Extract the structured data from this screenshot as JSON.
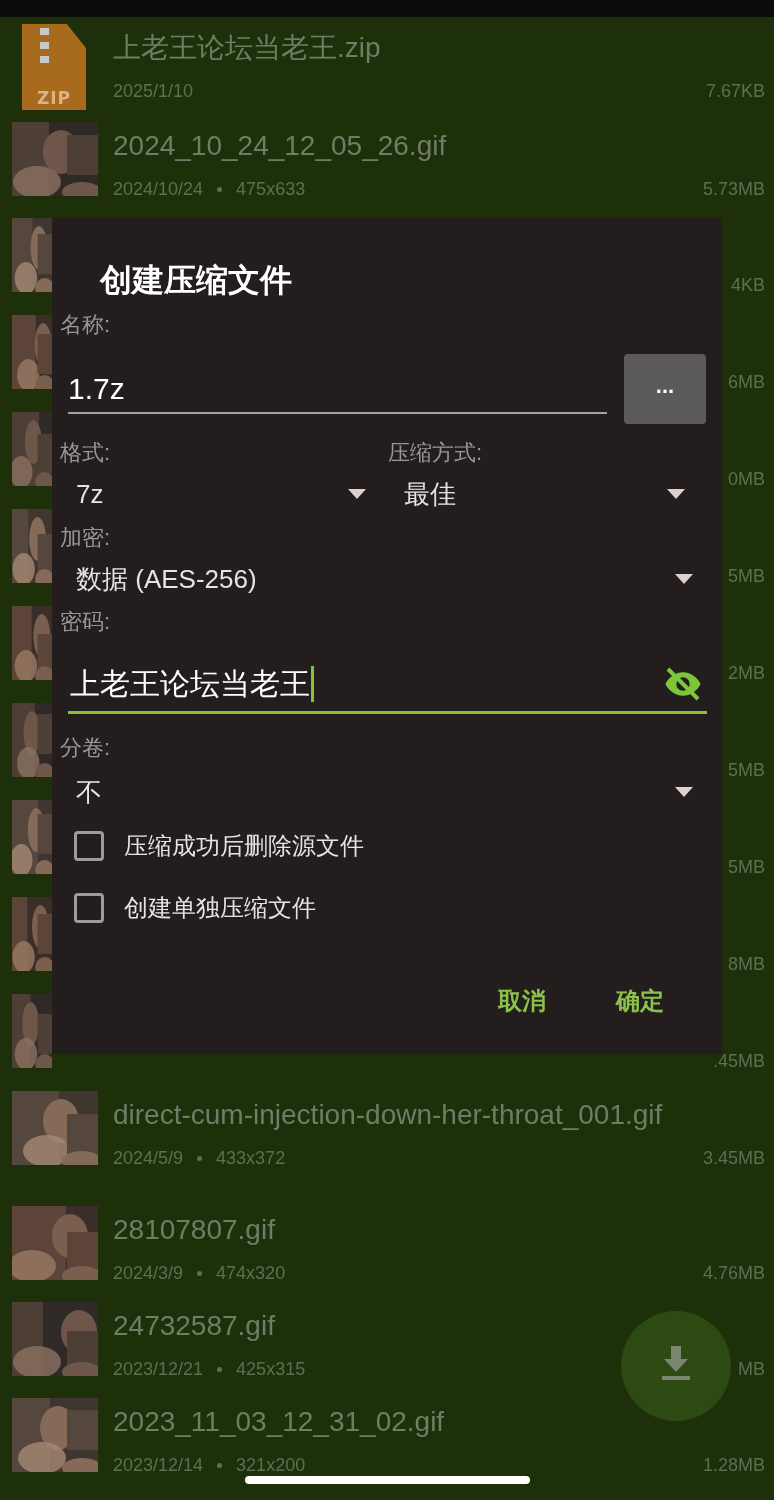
{
  "file_list": {
    "rows": [
      {
        "kind": "zip",
        "icon_label": "ZIP",
        "name": "上老王论坛当老王.zip",
        "date": "2025/1/10",
        "size": "7.67KB"
      },
      {
        "name": "2024_10_24_12_05_26.gif",
        "date": "2024/10/24",
        "dimensions": "475x633",
        "size": "5.73MB"
      },
      {
        "size": "4KB"
      },
      {
        "size": "6MB"
      },
      {
        "size": "0MB"
      },
      {
        "size": "5MB"
      },
      {
        "size": "2MB"
      },
      {
        "size": "5MB"
      },
      {
        "size": "5MB"
      },
      {
        "size": "8MB"
      },
      {
        "size": ".45MB"
      },
      {
        "name": "direct-cum-injection-down-her-throat_001.gif",
        "date": "2024/5/9",
        "dimensions": "433x372",
        "size": "3.45MB"
      },
      {
        "name": "28107807.gif",
        "date": "2024/3/9",
        "dimensions": "474x320",
        "size": "4.76MB"
      },
      {
        "name": "24732587.gif",
        "date": "2023/12/21",
        "dimensions": "425x315",
        "size": "MB"
      },
      {
        "name": "2023_11_03_12_31_02.gif",
        "date": "2023/12/14",
        "dimensions": "321x200",
        "size": "1.28MB"
      }
    ]
  },
  "dialog": {
    "title": "创建压缩文件",
    "name_label": "名称:",
    "name_field": {
      "value": "1.7z",
      "focused": false
    },
    "browse_button": "...",
    "format_label": "格式:",
    "format": "7z",
    "method_label": "压缩方式:",
    "method": "最佳",
    "encryption_label": "加密:",
    "encryption": "数据 (AES-256)",
    "password_label": "密码:",
    "password_field": {
      "value": "上老王论坛当老王",
      "focused": true,
      "password_visible": true
    },
    "split_label": "分卷:",
    "split": "不",
    "options": [
      {
        "label": "压缩成功后删除源文件",
        "checked": false
      },
      {
        "label": "创建单独压缩文件",
        "checked": false
      }
    ],
    "buttons": [
      "取消",
      "确定"
    ]
  },
  "fab": {
    "kind": "download"
  }
}
